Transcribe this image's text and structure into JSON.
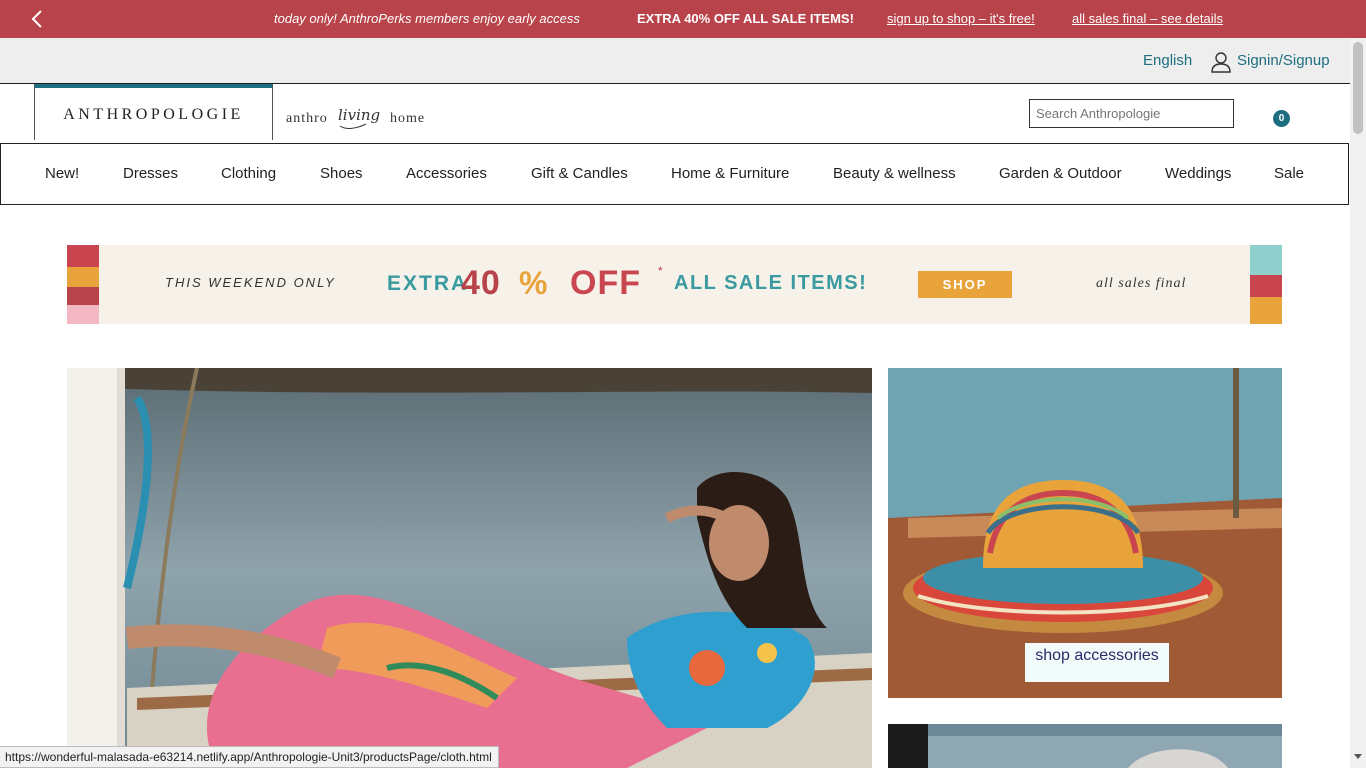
{
  "promo": {
    "message": "today only! AnthroPerks members enjoy early access",
    "headline": "EXTRA 40% OFF ALL SALE ITEMS!",
    "signup_link": "sign up to shop – it's free!",
    "details_link": "all sales final – see details",
    "background": "#b9434a"
  },
  "utility": {
    "language": "English",
    "signin": "Signin/Signup"
  },
  "header": {
    "brand": "ANTHROPOLOGIE",
    "living_logo": {
      "left": "anthro",
      "script": "living",
      "right": "home"
    },
    "search_placeholder": "Search Anthropologie",
    "cart_count": "0",
    "accent": "#1d6f80"
  },
  "nav": {
    "items": [
      "New!",
      "Dresses",
      "Clothing",
      "Shoes",
      "Accessories",
      "Gift & Candles",
      "Home & Furniture",
      "Beauty & wellness",
      "Garden & Outdoor",
      "Weddings",
      "Sale"
    ]
  },
  "banner": {
    "weekend": "THIS WEEKEND ONLY",
    "extra": "EXTRA",
    "forty": "40",
    "percent": "%",
    "off": "OFF",
    "asterisk": "*",
    "all_sale": "ALL SALE ITEMS!",
    "shop": "SHOP",
    "final": "all sales final"
  },
  "promos": {
    "shop_accessories": "shop accessories"
  },
  "status_url": "https://wonderful-malasada-e63214.netlify.app/Anthropologie-Unit3/productsPage/cloth.html"
}
